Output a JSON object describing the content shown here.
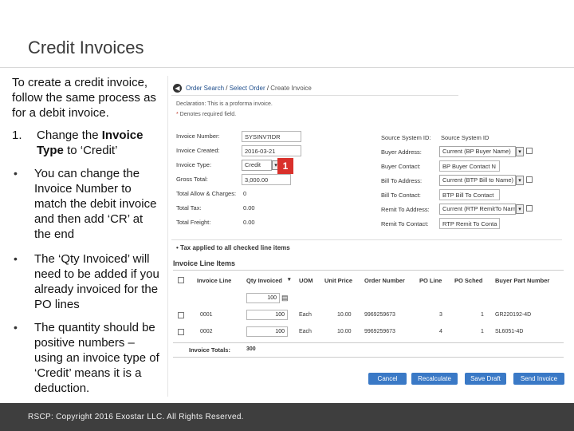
{
  "slide": {
    "title": "Credit Invoices",
    "intro": "To create a credit invoice, follow the same process as for a debit invoice.",
    "step_number": "1.",
    "step_text_1": "Change the ",
    "step_bold_1": "Invoice",
    "step_bold_2": "Type",
    "step_text_2": " to ‘Credit’",
    "bullets": [
      "You can change the Invoice Number to match the debit invoice and then add ‘CR’ at the end",
      "The ‘Qty Invoiced’ will need to be added if you already invoiced for the PO lines",
      "The quantity should be positive numbers – using an invoice type of ‘Credit’ means it is a deduction."
    ],
    "footer": "RSCP: Copyright 2016 Exostar LLC. All Rights Reserved."
  },
  "screenshot": {
    "breadcrumb": {
      "part1": "Order Search",
      "sep": " / ",
      "part2": "Select Order",
      "part3": "Create Invoice"
    },
    "declaration": "Declaration: This is a proforma invoice.",
    "required_note": "Denotes required field.",
    "left_fields": [
      {
        "label": "Invoice Number:",
        "value": "SYSINV7IDR",
        "kind": "input"
      },
      {
        "label": "Invoice Created:",
        "value": "2016-03-21",
        "kind": "input"
      },
      {
        "label": "Invoice Type:",
        "value": "Credit",
        "kind": "select"
      },
      {
        "label": "Gross Total:",
        "value": "3,000.00",
        "kind": "input"
      },
      {
        "label": "Total Allow & Charges:",
        "value": "0",
        "kind": "text"
      },
      {
        "label": "Total Tax:",
        "value": "0.00",
        "kind": "text"
      },
      {
        "label": "Total Freight:",
        "value": "0.00",
        "kind": "text"
      }
    ],
    "right_fields": [
      {
        "label": "Source System ID:",
        "value": "Source System ID",
        "kind": "text"
      },
      {
        "label": "Buyer Address:",
        "value": "Current (BP Buyer Name)",
        "kind": "select"
      },
      {
        "label": "Buyer Contact:",
        "value": "BP Buyer Contact N",
        "kind": "input"
      },
      {
        "label": "Bill To Address:",
        "value": "Current (BTP Bill to Name)",
        "kind": "select"
      },
      {
        "label": "Bill To Contact:",
        "value": "BTP Bill To Contact",
        "kind": "input"
      },
      {
        "label": "Remit To Address:",
        "value": "Current (RTP RemitTo Nam",
        "kind": "select"
      },
      {
        "label": "Remit To Contact:",
        "value": "RTP Remit To Conta",
        "kind": "input"
      }
    ],
    "callout_number": "1",
    "tax_note": "Tax applied to all checked line items",
    "table_title": "Invoice Line Items",
    "columns": [
      "Invoice Line",
      "Qty Invoiced",
      "UOM",
      "Unit Price",
      "Order Number",
      "PO Line",
      "PO Sched",
      "Buyer Part Number"
    ],
    "qty_all_value": "100",
    "rows": [
      {
        "line": "0001",
        "qty": "100",
        "uom": "Each",
        "price": "10.00",
        "order": "9969259673",
        "po_line": "3",
        "sched": "1",
        "part": "GR220192-4D"
      },
      {
        "line": "0002",
        "qty": "100",
        "uom": "Each",
        "price": "10.00",
        "order": "9969259673",
        "po_line": "4",
        "sched": "1",
        "part": "SL6051-4D"
      }
    ],
    "invoice_totals_label": "Invoice Totals:",
    "invoice_totals_value": "300",
    "buttons": [
      "Cancel",
      "Recalculate",
      "Save Draft",
      "Send Invoice"
    ]
  },
  "colors": {
    "accent_blue": "#3a79c6",
    "callout_red": "#d9302b",
    "footer_bg": "#3e3e3e"
  }
}
